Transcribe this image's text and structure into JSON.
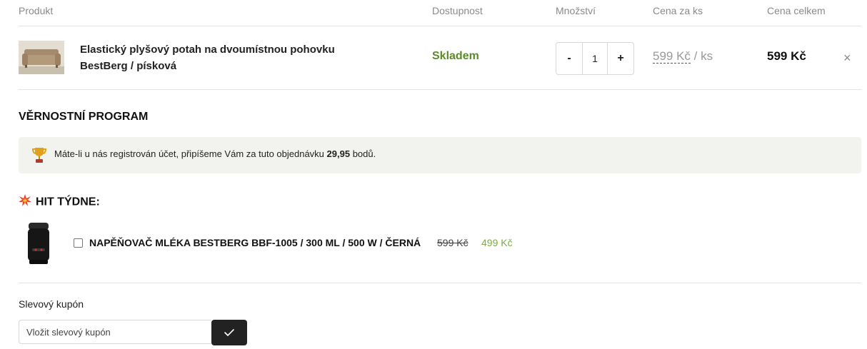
{
  "table": {
    "headers": [
      "Produkt",
      "Dostupnost",
      "Množství",
      "Cena za ks",
      "Cena celkem"
    ]
  },
  "cart_item": {
    "name_line1": "Elastický plyšový potah na dvoumístnou pohovku",
    "name_line2": "BestBerg / písková",
    "availability": "Skladem",
    "quantity": "1",
    "minus_label": "-",
    "plus_label": "+",
    "unit_price": "599 Kč",
    "unit_suffix": " / ks",
    "total_price": "599 Kč",
    "remove_label": "×"
  },
  "loyalty": {
    "title": "VĚRNOSTNÍ PROGRAM",
    "text_before": "Máte-li u nás registrován účet, připíšeme Vám za tuto objednávku ",
    "points": "29,95",
    "text_after": " bodů."
  },
  "hit": {
    "title": "HIT TÝDNE:",
    "product_name": "NAPĚŇOVAČ MLÉKA BESTBERG BBF-1005 / 300 ML / 500 W / ČERNÁ",
    "old_price": "599 Kč",
    "new_price": "499 Kč",
    "checked": false
  },
  "coupon": {
    "label": "Slevový kupón",
    "placeholder": "Vložit slevový kupón"
  },
  "icons": {
    "remove": "close-icon",
    "loyalty": "trophy-icon",
    "hit": "burst-icon",
    "coupon_submit": "checkmark-icon"
  },
  "colors": {
    "availability": "#5c8a2c",
    "hit_new_price": "#7cab48",
    "loyalty_bg": "#f2f2ee",
    "coupon_button": "#222222"
  }
}
